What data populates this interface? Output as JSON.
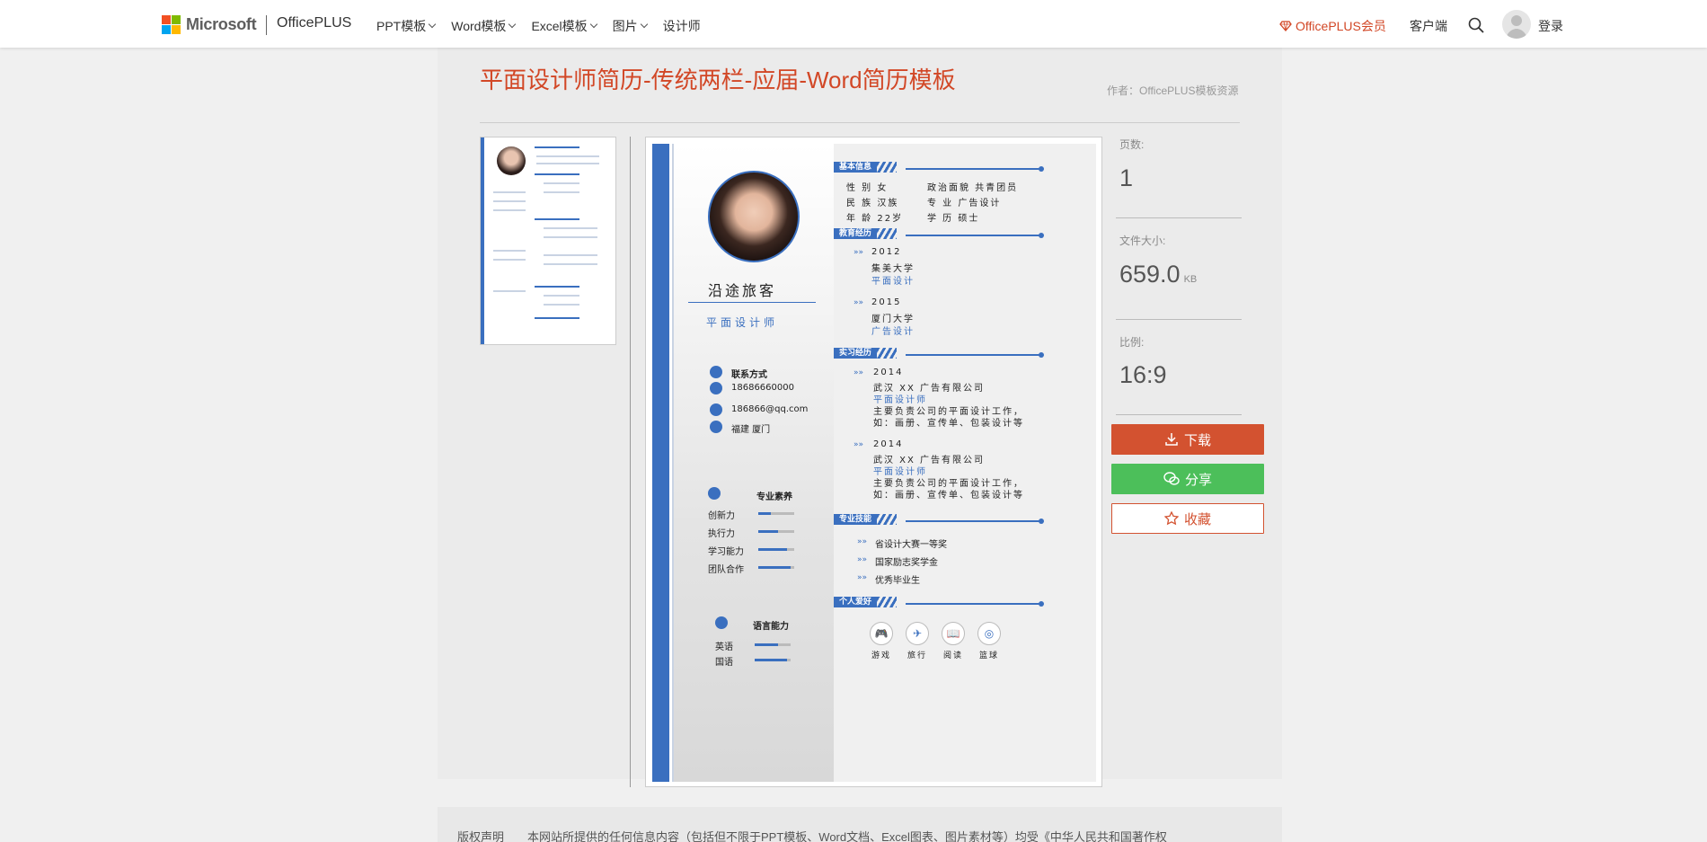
{
  "header": {
    "ms_brand": "Microsoft",
    "site_name": "OfficePLUS",
    "nav": [
      {
        "label": "PPT模板",
        "has_dropdown": true
      },
      {
        "label": "Word模板",
        "has_dropdown": true
      },
      {
        "label": "Excel模板",
        "has_dropdown": true
      },
      {
        "label": "图片",
        "has_dropdown": true
      },
      {
        "label": "设计师",
        "has_dropdown": false
      }
    ],
    "vip_label": "OfficePLUS会员",
    "client_label": "客户端",
    "login_label": "登录"
  },
  "page": {
    "title": "平面设计师简历-传统两栏-应届-Word简历模板",
    "author": "作者：OfficePLUS模板资源"
  },
  "resume": {
    "name": "沿途旅客",
    "role": "平面设计师",
    "contact_heading": "联系方式",
    "contacts": [
      "18686660000",
      "186866@qq.com",
      "福建  厦门"
    ],
    "skills_heading": "专业素养",
    "skills": [
      {
        "label": "创新力",
        "level": 0.35
      },
      {
        "label": "执行力",
        "level": 0.55
      },
      {
        "label": "学习能力",
        "level": 0.8
      },
      {
        "label": "团队合作",
        "level": 0.9
      }
    ],
    "languages_heading": "语言能力",
    "languages": [
      {
        "label": "英语",
        "level": 0.65
      },
      {
        "label": "国语",
        "level": 0.9
      }
    ],
    "sections": {
      "basic": "基本信息",
      "education": "教育经历",
      "internship": "实习经历",
      "skills": "专业技能",
      "hobbies": "个人爱好"
    },
    "basic_info": {
      "col1": [
        "性 别  女",
        "民 族  汉族",
        "年 龄  22岁"
      ],
      "col2": [
        "政治面貌  共青团员",
        "专    业  广告设计",
        "学    历  硕士"
      ]
    },
    "education": [
      {
        "year": "2012",
        "school": "集美大学",
        "major": "平面设计"
      },
      {
        "year": "2015",
        "school": "厦门大学",
        "major": "广告设计"
      }
    ],
    "internship": [
      {
        "year": "2014",
        "company": "武汉 XX 广告有限公司",
        "position": "平面设计师",
        "desc1": "主要负责公司的平面设计工作，",
        "desc2": "如：画册、宣传单、包装设计等"
      },
      {
        "year": "2014",
        "company": "武汉 XX 广告有限公司",
        "position": "平面设计师",
        "desc1": "主要负责公司的平面设计工作，",
        "desc2": "如：画册、宣传单、包装设计等"
      }
    ],
    "awards": [
      "省设计大赛一等奖",
      "国家励志奖学金",
      "优秀毕业生"
    ],
    "hobbies": [
      {
        "label": "游戏",
        "icon": "gamepad-icon",
        "glyph": "🎮"
      },
      {
        "label": "旅行",
        "icon": "airplane-icon",
        "glyph": "✈"
      },
      {
        "label": "阅读",
        "icon": "book-icon",
        "glyph": "📖"
      },
      {
        "label": "篮球",
        "icon": "basketball-icon",
        "glyph": "◎"
      }
    ]
  },
  "info": {
    "pages_label": "页数:",
    "pages_value": "1",
    "size_label": "文件大小:",
    "size_value": "659.0",
    "size_unit": "KB",
    "ratio_label": "比例:",
    "ratio_value": "16:9"
  },
  "actions": {
    "download": "下载",
    "share": "分享",
    "favorite": "收藏"
  },
  "footer": {
    "copyright_label": "版权声明",
    "copyright_text": "本网站所提供的任何信息内容（包括但不限于PPT模板、Word文档、Excel图表、图片素材等）均受《中华人民共和国著作权"
  },
  "colors": {
    "accent": "#d24726",
    "resume_blue": "#3a6fbf",
    "share_green": "#4cbf5a"
  }
}
